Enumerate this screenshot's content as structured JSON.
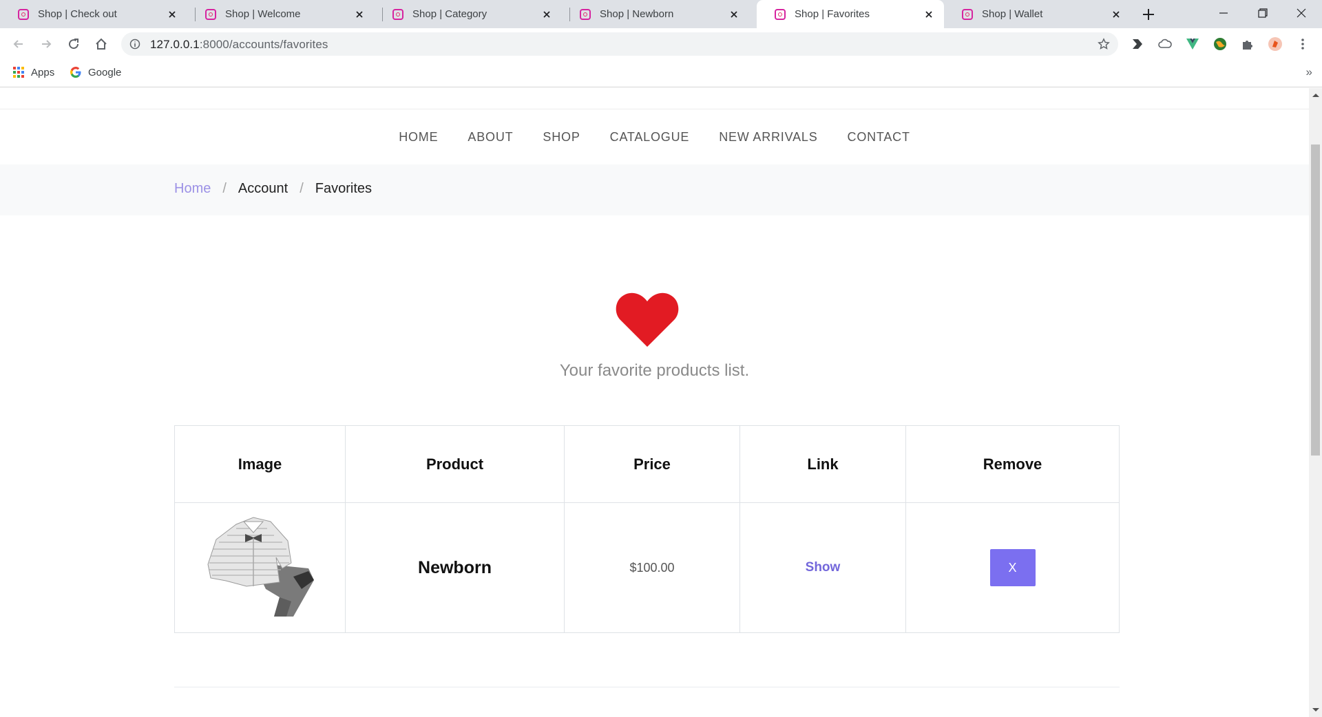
{
  "browser": {
    "tabs": [
      {
        "title": "Shop | Check out",
        "active": false
      },
      {
        "title": "Shop | Welcome",
        "active": false
      },
      {
        "title": "Shop | Category",
        "active": false
      },
      {
        "title": "Shop | Newborn",
        "active": false
      },
      {
        "title": "Shop | Favorites",
        "active": true
      },
      {
        "title": "Shop | Wallet",
        "active": false
      }
    ],
    "url_host": "127.0.0.1",
    "url_path": ":8000/accounts/favorites",
    "bookmarks": [
      {
        "label": "Apps",
        "icon": "apps-grid-icon"
      },
      {
        "label": "Google",
        "icon": "google-icon"
      }
    ],
    "bookmarks_more": "»"
  },
  "nav": {
    "items": [
      "HOME",
      "ABOUT",
      "SHOP",
      "CATALOGUE",
      "NEW ARRIVALS",
      "CONTACT"
    ]
  },
  "breadcrumb": {
    "home": "Home",
    "separator": "/",
    "account": "Account",
    "current": "Favorites"
  },
  "favorites": {
    "icon": "heart-icon",
    "intro": "Your favorite products list.",
    "columns": [
      "Image",
      "Product",
      "Price",
      "Link",
      "Remove"
    ],
    "rows": [
      {
        "product": "Newborn",
        "price": "$100.00",
        "link_label": "Show",
        "remove_label": "X"
      }
    ]
  },
  "colors": {
    "accent": "#7b6ff0",
    "heart": "#e21b23",
    "link": "#7367db"
  }
}
